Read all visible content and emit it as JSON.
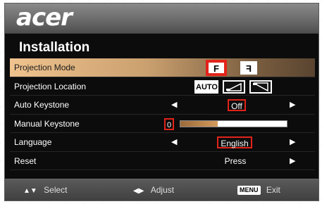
{
  "brand": "acer",
  "page_title": "Installation",
  "colors": {
    "highlight": "#e2231a",
    "selected_row": "#d9ab78",
    "background": "#0c0c0c"
  },
  "rows": [
    {
      "label": "Projection Mode",
      "options": [
        "F",
        "F"
      ]
    },
    {
      "label": "Projection Location",
      "options": [
        "AUTO",
        "desk-front-icon",
        "ceiling-front-icon"
      ]
    },
    {
      "label": "Auto Keystone",
      "value": "Off"
    },
    {
      "label": "Manual Keystone",
      "value": "0",
      "level": 0.35
    },
    {
      "label": "Language",
      "value": "English"
    },
    {
      "label": "Reset",
      "value": "Press"
    }
  ],
  "footer": {
    "select": "Select",
    "adjust": "Adjust",
    "menu_key": "MENU",
    "exit": "Exit"
  }
}
